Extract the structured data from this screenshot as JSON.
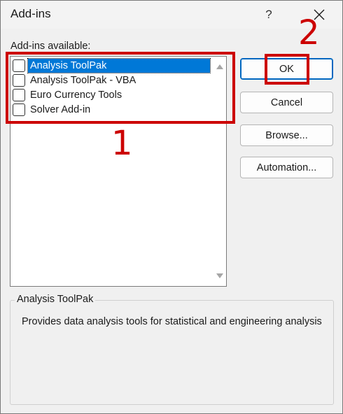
{
  "dialog": {
    "title": "Add-ins",
    "help_label": "?",
    "close_icon": "close-icon"
  },
  "addins": {
    "label": "Add-ins available:",
    "items": [
      {
        "label": "Analysis ToolPak",
        "checked": false,
        "selected": true
      },
      {
        "label": "Analysis ToolPak - VBA",
        "checked": false,
        "selected": false
      },
      {
        "label": "Euro Currency Tools",
        "checked": false,
        "selected": false
      },
      {
        "label": "Solver Add-in",
        "checked": false,
        "selected": false
      }
    ]
  },
  "buttons": {
    "ok": "OK",
    "cancel": "Cancel",
    "browse": "Browse...",
    "automation": "Automation..."
  },
  "description": {
    "title": "Analysis ToolPak",
    "text": "Provides data analysis tools for statistical and engineering analysis"
  },
  "annotations": {
    "step1": "1",
    "step2": "2",
    "color": "#cc0000"
  },
  "colors": {
    "selection": "#0078d7",
    "dialog_bg": "#f0f0f0",
    "default_button_border": "#0067c0"
  }
}
